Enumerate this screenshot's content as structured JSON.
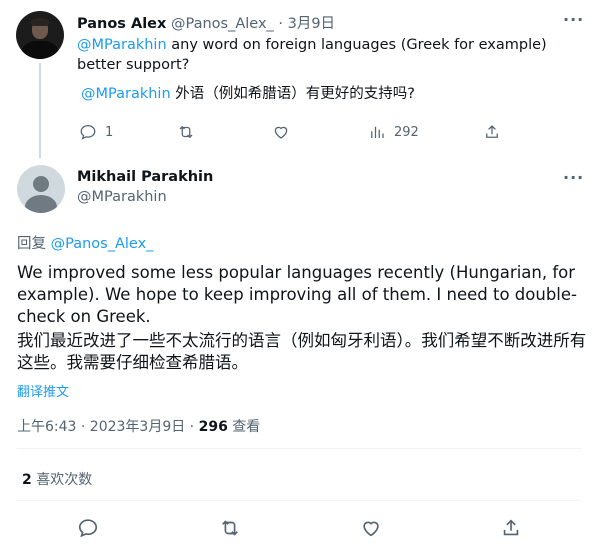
{
  "tweet1": {
    "author_name": "Panos Alex",
    "handle": "@Panos_Alex_",
    "separator": "·",
    "date": "3月9日",
    "mention": "@MParakhin",
    "text": " any word on foreign languages (Greek for example) better support?",
    "translation_mention": "@MParakhin",
    "translation_text": " 外语（例如希腊语）有更好的支持吗?",
    "actions": {
      "reply_count": "1",
      "retweet_count": "",
      "like_count": "",
      "view_count": "292"
    }
  },
  "tweet2": {
    "author_name": "Mikhail Parakhin",
    "handle": "@MParakhin",
    "replying_label": "回复 ",
    "replying_to": "@Panos_Alex_",
    "text_en": "We improved some less popular languages recently (Hungarian, for example). We hope to keep improving all of them. I need to double-check on Greek.",
    "text_zh": "我们最近改进了一些不太流行的语言（例如匈牙利语）。我们希望不断改进所有这些。我需要仔细检查希腊语。",
    "translate_label": "翻译推文",
    "timestamp": "上午6:43 · 2023年3月9日 · ",
    "views_count": "296",
    "views_label": " 查看",
    "likes_count": "2",
    "likes_label": " 喜欢次数"
  },
  "icons": [
    "more-icon",
    "reply-icon",
    "retweet-icon",
    "like-icon",
    "views-icon",
    "share-icon"
  ],
  "colors": {
    "link": "#1d9bf0",
    "muted": "#536471",
    "text": "#0f1419"
  }
}
